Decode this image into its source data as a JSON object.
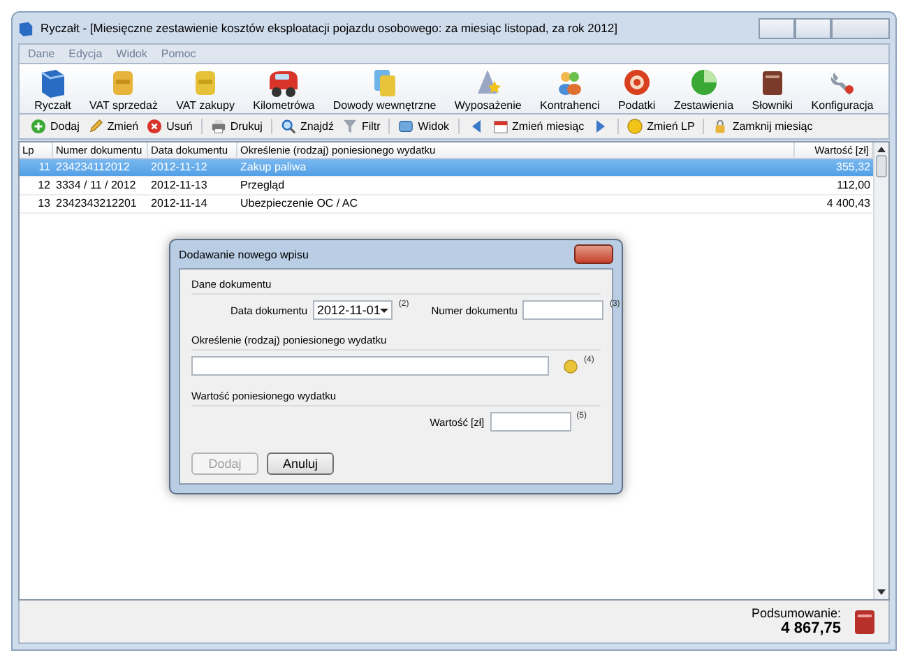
{
  "window": {
    "title": "Ryczałt - [Miesięczne zestawienie kosztów eksploatacji pojazdu osobowego: za miesiąc listopad, za rok 2012]"
  },
  "menu": [
    "Dane",
    "Edycja",
    "Widok",
    "Pomoc"
  ],
  "modules": [
    "Ryczałt",
    "VAT sprzedaż",
    "VAT zakupy",
    "Kilometrówa",
    "Dowody wewnętrzne",
    "Wyposażenie",
    "Kontrahenci",
    "Podatki",
    "Zestawienia",
    "Słowniki",
    "Konfiguracja"
  ],
  "toolbar": [
    [
      {
        "kind": "add",
        "label": "Dodaj"
      },
      {
        "kind": "edit",
        "label": "Zmień"
      },
      {
        "kind": "delete",
        "label": "Usuń"
      }
    ],
    [
      {
        "kind": "print",
        "label": "Drukuj"
      }
    ],
    [
      {
        "kind": "find",
        "label": "Znajdź"
      },
      {
        "kind": "filter",
        "label": "Filtr"
      }
    ],
    [
      {
        "kind": "view",
        "label": "Widok"
      }
    ],
    [
      {
        "kind": "prev"
      },
      {
        "kind": "calendar",
        "label": "Zmień miesiąc"
      },
      {
        "kind": "next"
      }
    ],
    [
      {
        "kind": "coin",
        "label": "Zmień LP"
      }
    ],
    [
      {
        "kind": "lock",
        "label": "Zamknij miesiąc"
      }
    ]
  ],
  "table": {
    "columns": [
      "Lp",
      "Numer dokumentu",
      "Data dokumentu",
      "Określenie (rodzaj) poniesionego wydatku",
      "Wartość [zł]"
    ],
    "rows": [
      {
        "cells": [
          "11",
          "234234112012",
          "2012-11-12",
          "Zakup paliwa",
          "355,32"
        ],
        "selected": true
      },
      {
        "cells": [
          "12",
          "3334 / 11 / 2012",
          "2012-11-13",
          "Przegląd",
          "112,00"
        ],
        "selected": false
      },
      {
        "cells": [
          "13",
          "2342343212201",
          "2012-11-14",
          "Ubezpieczenie OC / AC",
          "4 400,43"
        ],
        "selected": false
      }
    ]
  },
  "summary": {
    "label": "Podsumowanie:",
    "value": "4 867,75"
  },
  "dialog": {
    "title": "Dodawanie nowego wpisu",
    "section1": "Dane dokumentu",
    "date": {
      "label": "Data dokumentu",
      "value": "2012-11-01",
      "mark": "(2)"
    },
    "number": {
      "label": "Numer dokumentu",
      "mark": "(3)"
    },
    "section2": "Określenie (rodzaj) poniesionego wydatku",
    "description": {
      "mark": "(4)"
    },
    "section3": "Wartość poniesionego wydatku",
    "amount": {
      "label": "Wartość [zł]",
      "mark": "(5)"
    },
    "buttons": [
      {
        "label": "Dodaj",
        "disabled": true
      },
      {
        "label": "Anuluj",
        "disabled": false
      }
    ]
  }
}
